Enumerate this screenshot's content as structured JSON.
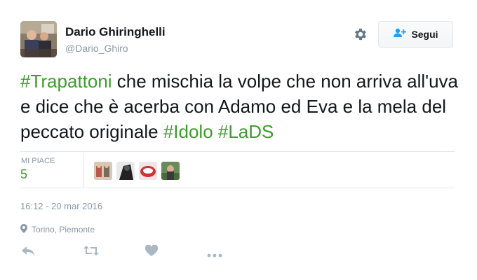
{
  "author": {
    "name": "Dario Ghiringhelli",
    "handle": "@Dario_Ghiro"
  },
  "follow_button": {
    "label": "Segui"
  },
  "tweet": {
    "segments": [
      {
        "text": "#Trapattoni",
        "hashtag": true
      },
      {
        "text": " che mischia la volpe che non arriva all'uva e dice che è acerba con Adamo ed Eva e la mela del peccato originale ",
        "hashtag": false
      },
      {
        "text": "#Idolo",
        "hashtag": true
      },
      {
        "text": " ",
        "hashtag": false
      },
      {
        "text": "#LaDS",
        "hashtag": true
      }
    ]
  },
  "stats": {
    "likes_label": "MI PIACE",
    "likes_count": "5"
  },
  "timestamp": "16:12 - 20 mar 2016",
  "location": "Torino, Piemonte",
  "actions": [
    "reply-icon",
    "retweet-icon",
    "like-icon",
    "more-icon"
  ],
  "colors": {
    "hashtag": "#3f9b2f",
    "muted": "#8899a6",
    "follow_icon": "#1da1f2"
  }
}
